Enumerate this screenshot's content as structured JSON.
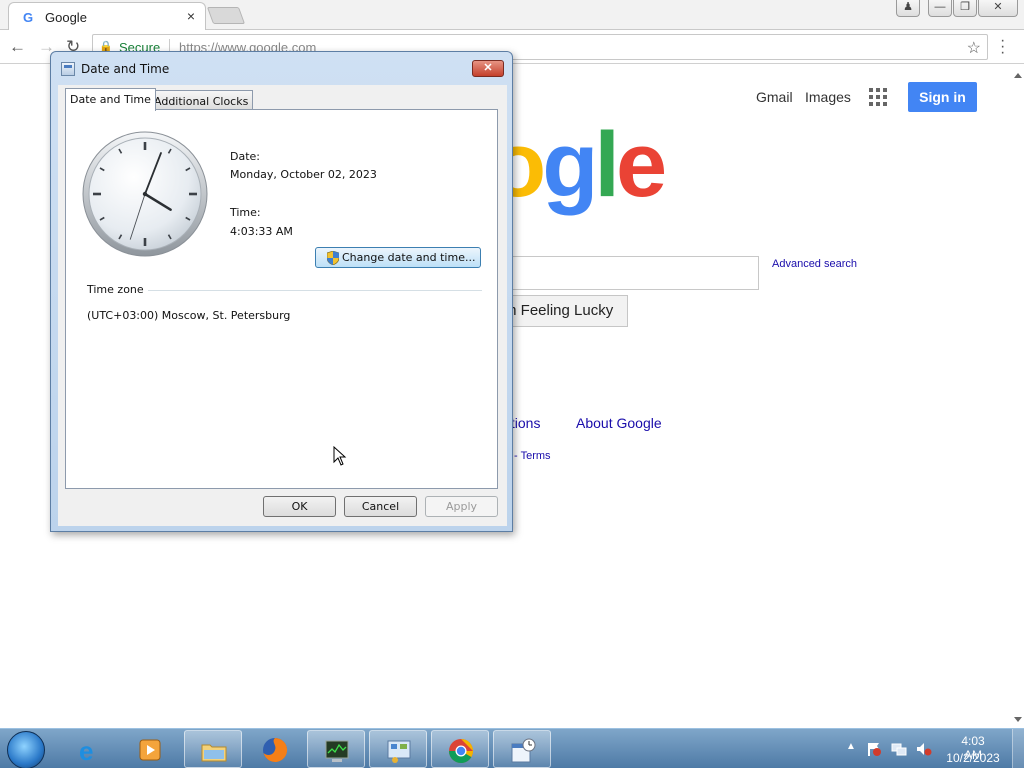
{
  "browser": {
    "tab_title": "Google",
    "tab_close": "×",
    "favicon_letter": "G",
    "address": {
      "secure_label": "Secure",
      "url": "https://www.google.com"
    },
    "window_buttons": [
      "user",
      "minimize",
      "restore",
      "close"
    ]
  },
  "google": {
    "header_links": {
      "gmail": "Gmail",
      "images": "Images"
    },
    "sign_in": "Sign in",
    "logo_visible_text": [
      "o",
      "g",
      "l",
      "e"
    ],
    "advanced_search": "Advanced search",
    "lucky_button": "m Feeling Lucky",
    "footer": {
      "solutions": "lutions",
      "about": "About Google",
      "privacy_terms": "cy - Terms"
    },
    "colors": {
      "blue": "#4285f4",
      "red": "#ea4335",
      "yellow": "#fbbc05",
      "green": "#34a853",
      "link": "#1a0dab"
    }
  },
  "dialog": {
    "title": "Date and Time",
    "tabs": [
      "Date and Time",
      "Additional Clocks"
    ],
    "date_label": "Date:",
    "date_value": "Monday, October 02, 2023",
    "time_label": "Time:",
    "time_value": "4:03:33 AM",
    "change_button": "Change date and time...",
    "timezone_heading": "Time zone",
    "timezone_value": "(UTC+03:00) Moscow, St. Petersburg",
    "buttons": {
      "ok": "OK",
      "cancel": "Cancel",
      "apply": "Apply"
    },
    "clock": {
      "hour": 4,
      "minute": 3,
      "second": 33
    }
  },
  "taskbar": {
    "items": [
      "internet-explorer",
      "media-center",
      "file-explorer",
      "firefox",
      "task-manager",
      "control-panel",
      "chrome",
      "date-time-settings"
    ],
    "clock_time": "4:03 AM",
    "clock_date": "10/2/2023",
    "tray_icons": [
      "action-center-flag",
      "network",
      "volume-muted"
    ]
  }
}
